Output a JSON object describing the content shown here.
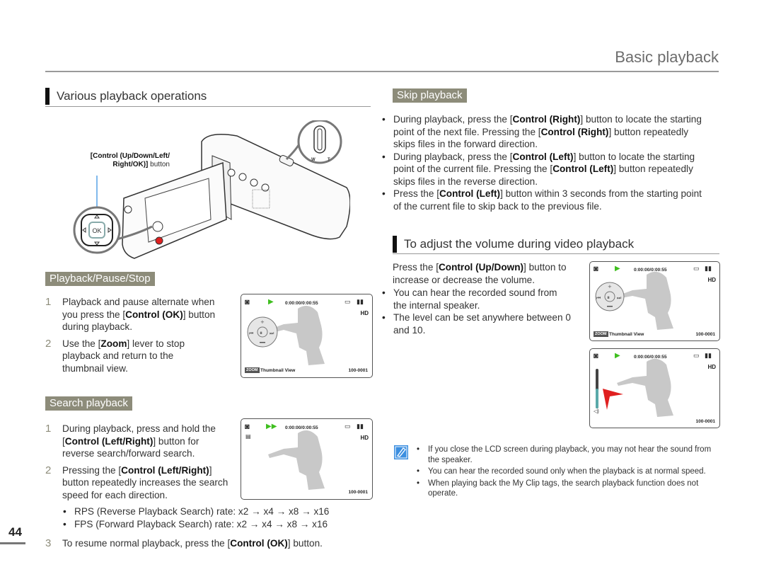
{
  "header": {
    "title": "Basic playback"
  },
  "page_number": "44",
  "left": {
    "section_title": "Various playback operations",
    "camera_callout": {
      "line1": "[Control (Up/Down/Left/",
      "line2_bold": "Right/OK)]",
      "line2_rest": " button",
      "ok_label": "OK",
      "w_label": "W",
      "t_label": "T"
    },
    "playback_pause_stop": {
      "tag": "Playback/Pause/Stop",
      "steps": [
        {
          "num": "1",
          "text_a": "Playback and pause alternate when you press the [",
          "bold": "Control (OK)",
          "text_b": "] button during playback."
        },
        {
          "num": "2",
          "text_a": "Use the [",
          "bold": "Zoom",
          "text_b": "] lever to stop playback and return to the thumbnail view."
        }
      ],
      "screen": {
        "time": "0:00:00/0:00:55",
        "hd": "HD",
        "zoom_badge": "ZOOM",
        "thumbnail_label": "Thumbnail View",
        "file_no": "100-0001"
      }
    },
    "search_playback": {
      "tag": "Search playback",
      "steps": [
        {
          "num": "1",
          "text_a": "During playback, press and hold the [",
          "bold": "Control (Left/Right)",
          "text_b": "] button for reverse search/forward search."
        },
        {
          "num": "2",
          "text_a": "Pressing the [",
          "bold": "Control (Left/Right)",
          "text_b": "] button repeatedly increases the search speed for each direction."
        }
      ],
      "bullets": [
        "RPS (Reverse Playback Search) rate: x2 → x4 → x8 → x16",
        "FPS (Forward Playback Search) rate: x2 → x4 → x8 → x16"
      ],
      "step3": {
        "num": "3",
        "text_a": "To resume normal playback, press the [",
        "bold": "Control (OK)",
        "text_b": "] button."
      },
      "screen": {
        "time": "0:00:00/0:00:55",
        "hd": "HD",
        "file_no": "100-0001"
      }
    }
  },
  "right": {
    "skip_playback": {
      "tag": "Skip playback",
      "bullets": [
        {
          "a": "During playback, press the [",
          "b1": "Control (Right)",
          "c": "] button to locate the starting point of the next file. Pressing the [",
          "b2": "Control (Right)",
          "d": "] button repeatedly skips files in the forward direction."
        },
        {
          "a": "During playback, press the [",
          "b1": "Control (Left)",
          "c": "] button to locate the starting point of the current file. Pressing the [",
          "b2": "Control (Left)",
          "d": "] button repeatedly skips files in the reverse direction."
        },
        {
          "a": "Press the [",
          "b1": "Control (Left)",
          "c": "] button within 3 seconds from the starting point of the current file to skip back to the previous file.",
          "b2": "",
          "d": ""
        }
      ]
    },
    "volume": {
      "section_title": "To adjust the volume during video playback",
      "intro_a": "Press the [",
      "intro_bold": "Control (Up/Down)",
      "intro_b": "] button to increase or decrease the volume.",
      "bullets": [
        "You can hear the recorded sound from the internal speaker.",
        "The level can be set anywhere between 0 and 10."
      ],
      "screen1": {
        "time": "0:00:00/0:00:55",
        "hd": "HD",
        "zoom_badge": "ZOOM",
        "thumbnail_label": "Thumbnail View",
        "file_no": "100-0001"
      },
      "screen2": {
        "time": "0:00:00/0:00:55",
        "hd": "HD",
        "file_no": "100-0001",
        "volume_level": 0.5
      }
    },
    "notes": [
      "If you close the LCD screen during playback, you may not hear the sound from the speaker.",
      "You can hear the recorded sound only when the playback is at normal speed.",
      "When playing back the My Clip tags, the search playback function does not operate."
    ]
  },
  "colors": {
    "tag_bg": "#8d8c7a",
    "play_green": "#3fbf1f",
    "note_blue": "#3c8fe0",
    "arrow_red": "#e02020",
    "volume_teal": "#5aa9a9",
    "callout_blue": "#2a8ae0"
  }
}
